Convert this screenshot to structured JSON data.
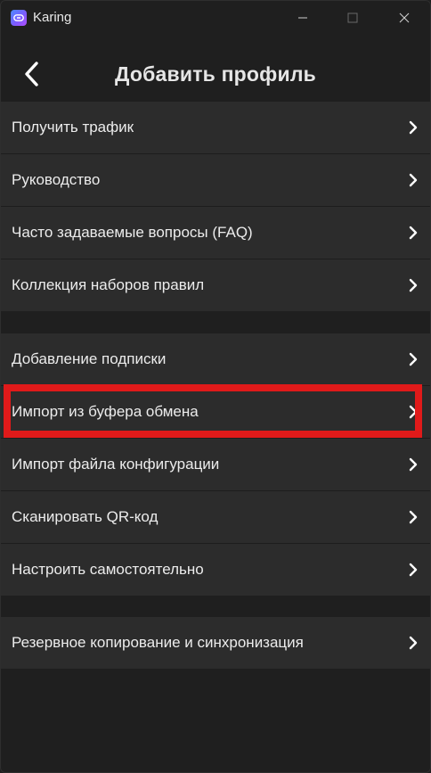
{
  "window": {
    "title": "Karing"
  },
  "header": {
    "title": "Добавить профиль"
  },
  "groups": [
    {
      "items": [
        {
          "label": "Получить трафик"
        },
        {
          "label": "Руководство"
        },
        {
          "label": "Часто задаваемые вопросы (FAQ)"
        },
        {
          "label": "Коллекция наборов правил"
        }
      ]
    },
    {
      "items": [
        {
          "label": "Добавление подписки"
        },
        {
          "label": "Импорт из буфера обмена"
        },
        {
          "label": "Импорт файла конфигурации"
        },
        {
          "label": "Сканировать QR-код"
        },
        {
          "label": "Настроить самостоятельно"
        }
      ]
    },
    {
      "items": [
        {
          "label": "Резервное копирование и синхронизация"
        }
      ]
    }
  ],
  "colors": {
    "background": "#1f1f1f",
    "row": "#2c2c2c",
    "highlight": "#e01a1a",
    "accent": "#7b5cff"
  },
  "icons": {
    "app": "karing-logo-icon",
    "back": "chevron-left-icon",
    "row": "chevron-right-icon"
  }
}
